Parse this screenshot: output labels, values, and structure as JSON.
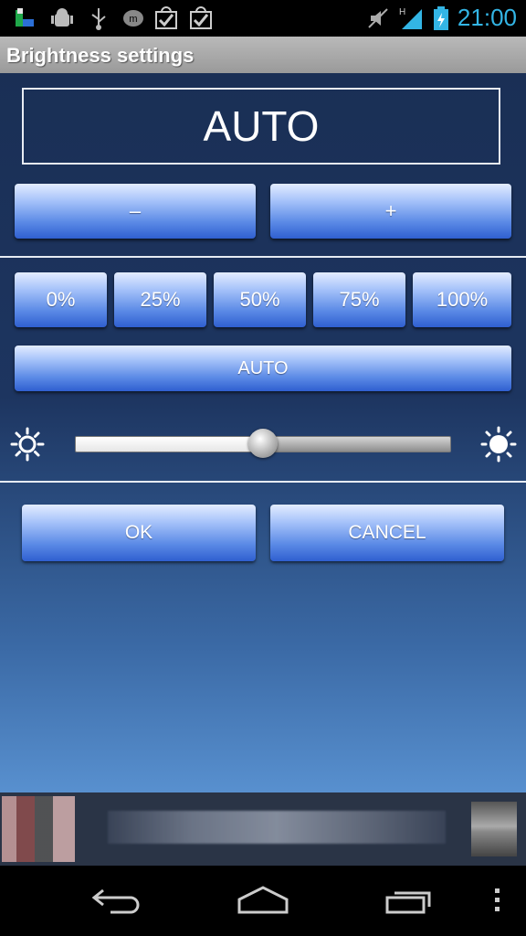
{
  "status_bar": {
    "time": "21:00",
    "icons": [
      "app-notification-icon",
      "android-debug-icon",
      "usb-icon",
      "messenger-icon",
      "download-complete-icon",
      "download-complete-icon",
      "mute-icon",
      "signal-h-icon",
      "battery-charging-icon"
    ]
  },
  "dialog": {
    "title": "Brightness settings",
    "display_value": "AUTO",
    "decrease_label": "–",
    "increase_label": "+",
    "presets": [
      "0%",
      "25%",
      "50%",
      "75%",
      "100%"
    ],
    "auto_label": "AUTO",
    "slider_level": 0.5,
    "ok_label": "OK",
    "cancel_label": "CANCEL"
  },
  "colors": {
    "accent_clock": "#33b5e5",
    "button_top": "#e3ecff",
    "button_bottom": "#2f5fd0",
    "background_top": "#1a2f55",
    "background_bottom": "#5890cf"
  },
  "nav_bar": {
    "icons": [
      "back-icon",
      "home-icon",
      "recent-apps-icon",
      "menu-icon"
    ]
  }
}
